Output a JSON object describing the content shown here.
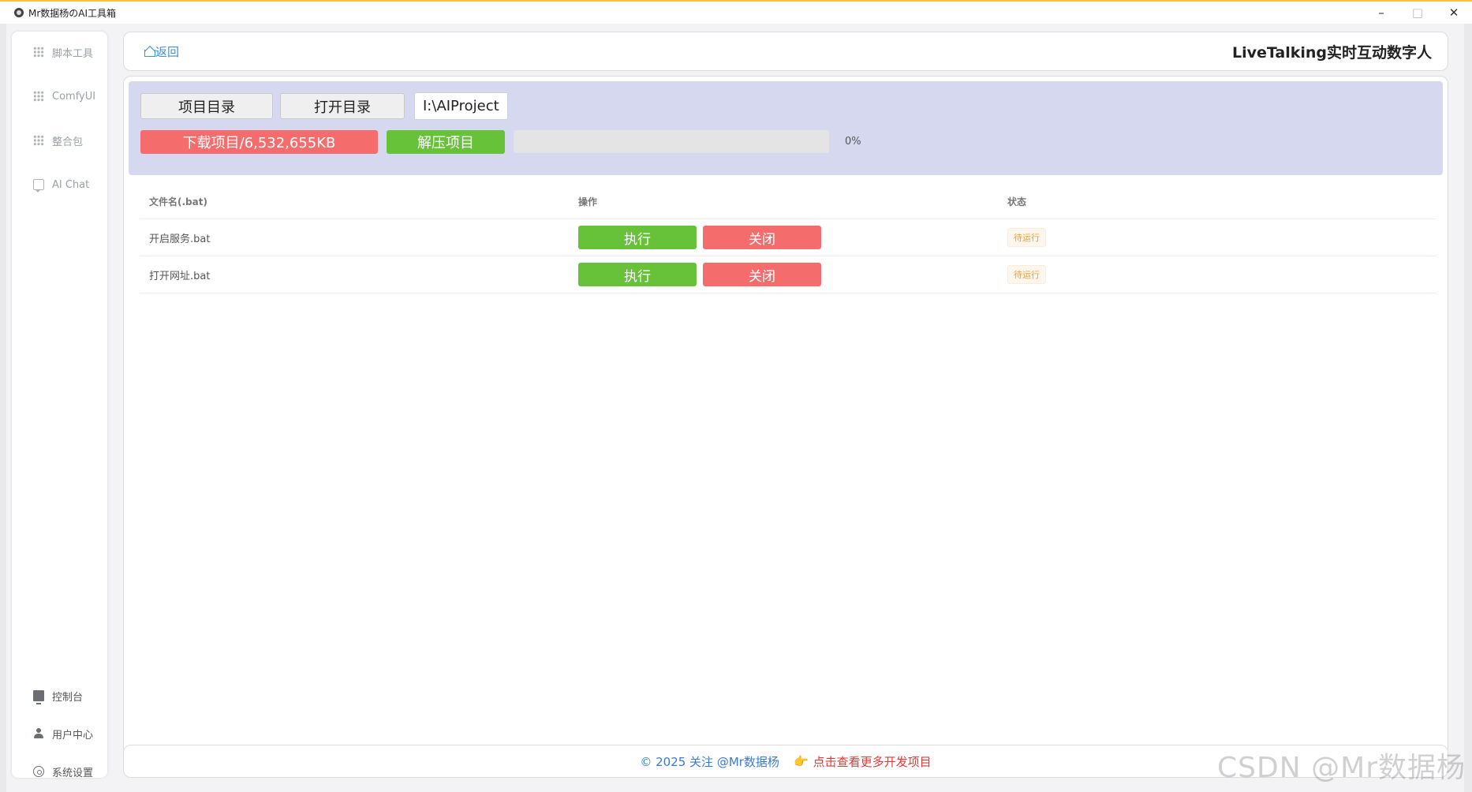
{
  "window": {
    "title": "Mr数据杨のAI工具箱",
    "minimize": "–",
    "maximize": "□",
    "close": "✕"
  },
  "sidebar": {
    "top_items": [
      {
        "label": "脚本工具",
        "icon": "grid-icon"
      },
      {
        "label": "ComfyUI",
        "icon": "grid-icon"
      },
      {
        "label": "整合包",
        "icon": "grid-icon"
      },
      {
        "label": "AI Chat",
        "icon": "chat-icon"
      }
    ],
    "bottom_items": [
      {
        "label": "控制台",
        "icon": "monitor-icon"
      },
      {
        "label": "用户中心",
        "icon": "user-icon"
      },
      {
        "label": "系统设置",
        "icon": "gear-icon"
      }
    ]
  },
  "header": {
    "back_label": "返回",
    "page_title": "LiveTalking实时互动数字人"
  },
  "toolbar": {
    "project_dir_label": "项目目录",
    "open_dir_label": "打开目录",
    "path_value": "I:\\AIProject",
    "download_label": "下载项目/6,532,655KB",
    "extract_label": "解压项目",
    "progress_value": 0,
    "progress_text": "0%"
  },
  "table": {
    "columns": [
      "文件名(.bat)",
      "操作",
      "状态"
    ],
    "rows": [
      {
        "file": "开启服务.bat",
        "run_label": "执行",
        "close_label": "关闭",
        "status": "待运行"
      },
      {
        "file": "打开网址.bat",
        "run_label": "执行",
        "close_label": "关闭",
        "status": "待运行"
      }
    ]
  },
  "footer": {
    "copyright": "© 2025 关注 @Mr数据杨",
    "hand_icon": "👉",
    "link_text": "点击查看更多开发项目"
  },
  "watermark": "CSDN @Mr数据杨",
  "colors": {
    "accent_blue": "#3b8fe0",
    "danger_red": "#f56c6c",
    "success_green": "#67c23a",
    "toolbar_bg": "#d6d8f0",
    "warning_tag": "#e6a23c"
  }
}
